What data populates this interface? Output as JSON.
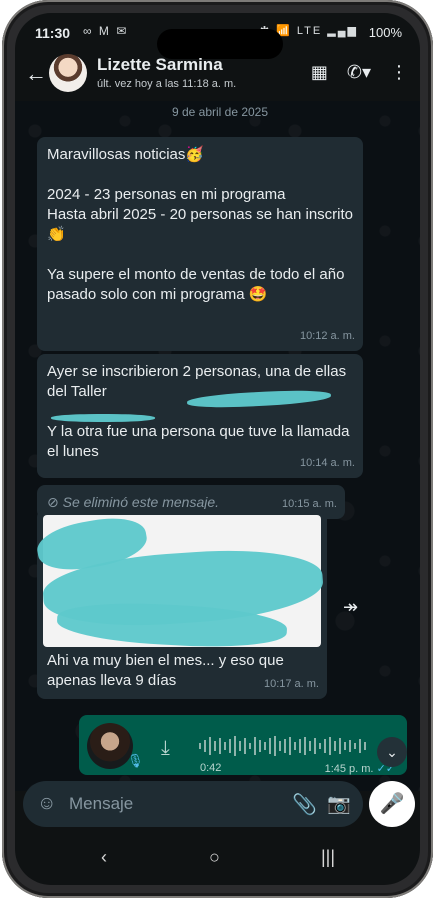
{
  "status": {
    "time": "11:30",
    "left_icons": "∞ M ✉",
    "right_icons": "✱ 📶 LTE ▂▄▆",
    "battery": "100%"
  },
  "contact": {
    "name": "Lizette Sarmina",
    "last_seen": "últ. vez hoy a las 11:18 a. m."
  },
  "header_icons": {
    "store": "store-icon",
    "call": "phone-icon",
    "menu": "more-vert-icon"
  },
  "date_chip": "9 de abril de 2025",
  "messages": [
    {
      "text": "Maravillosas noticias🥳\n\n2024 - 23 personas en mi programa\nHasta abril 2025 - 20 personas se han inscrito 👏\n\nYa supere el monto de ventas de todo el año pasado solo con mi programa 🤩",
      "time": "10:12 a. m."
    },
    {
      "text": "Ayer se inscribieron 2 personas, una de ellas del Taller\n\nY la otra fue una persona que tuve la llamada el lunes",
      "time": "10:14 a. m."
    },
    {
      "text": "Se eliminó este mensaje.",
      "time": "10:15 a. m."
    },
    {
      "text": "Ahi va muy bien el mes... y eso que apenas lleva 9 días",
      "time": "10:17 a. m."
    }
  ],
  "voice_note": {
    "duration": "0:42",
    "time": "1:45 p. m.",
    "status_icon": "double-check-icon"
  },
  "input": {
    "placeholder": "Mensaje"
  },
  "colors": {
    "incoming_bubble": "#202c33",
    "outgoing_bubble": "#005c4b",
    "redaction": "#5ec9cc"
  }
}
